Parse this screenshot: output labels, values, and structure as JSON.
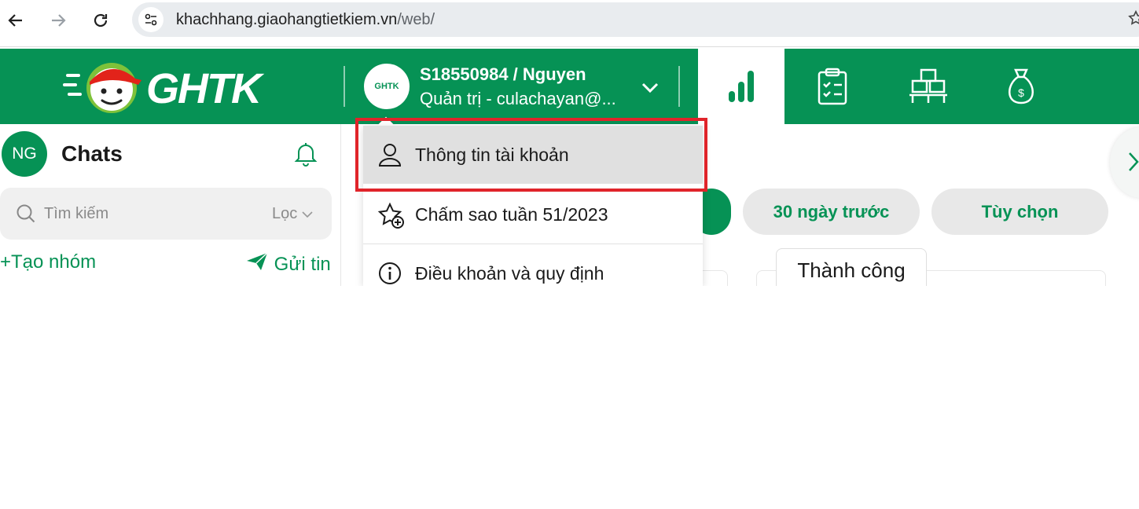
{
  "browser": {
    "url_host": "khachhang.giaohangtietkiem.vn",
    "url_path": "/web/"
  },
  "header": {
    "logo_text": "GHTK",
    "avatar_text": "GHTK",
    "account_name": "S18550984 / Nguyen",
    "account_role": "Quản trị - culachayan@...",
    "tabs": [
      "stats-tab",
      "orders-tab",
      "warehouse-tab",
      "money-tab"
    ]
  },
  "sidebar": {
    "avatar_initials": "NG",
    "title": "Chats",
    "search_placeholder": "Tìm kiếm",
    "filter_label": "Lọc",
    "create_group_label": "Tạo nhóm",
    "send_message_label": "Gửi tin"
  },
  "main": {
    "filters": [
      "30 ngày trước",
      "Tùy chọn"
    ],
    "card_tab_label": "Thành công"
  },
  "dropdown": {
    "items": [
      {
        "label": "Thông tin tài khoản",
        "icon": "user-icon"
      },
      {
        "label": "Chấm sao tuần 51/2023",
        "icon": "star-plus-icon"
      },
      {
        "label": "Điều khoản và quy định",
        "icon": "info-icon"
      }
    ]
  },
  "colors": {
    "brand_green": "#069255",
    "highlight_red": "#e0242a"
  }
}
